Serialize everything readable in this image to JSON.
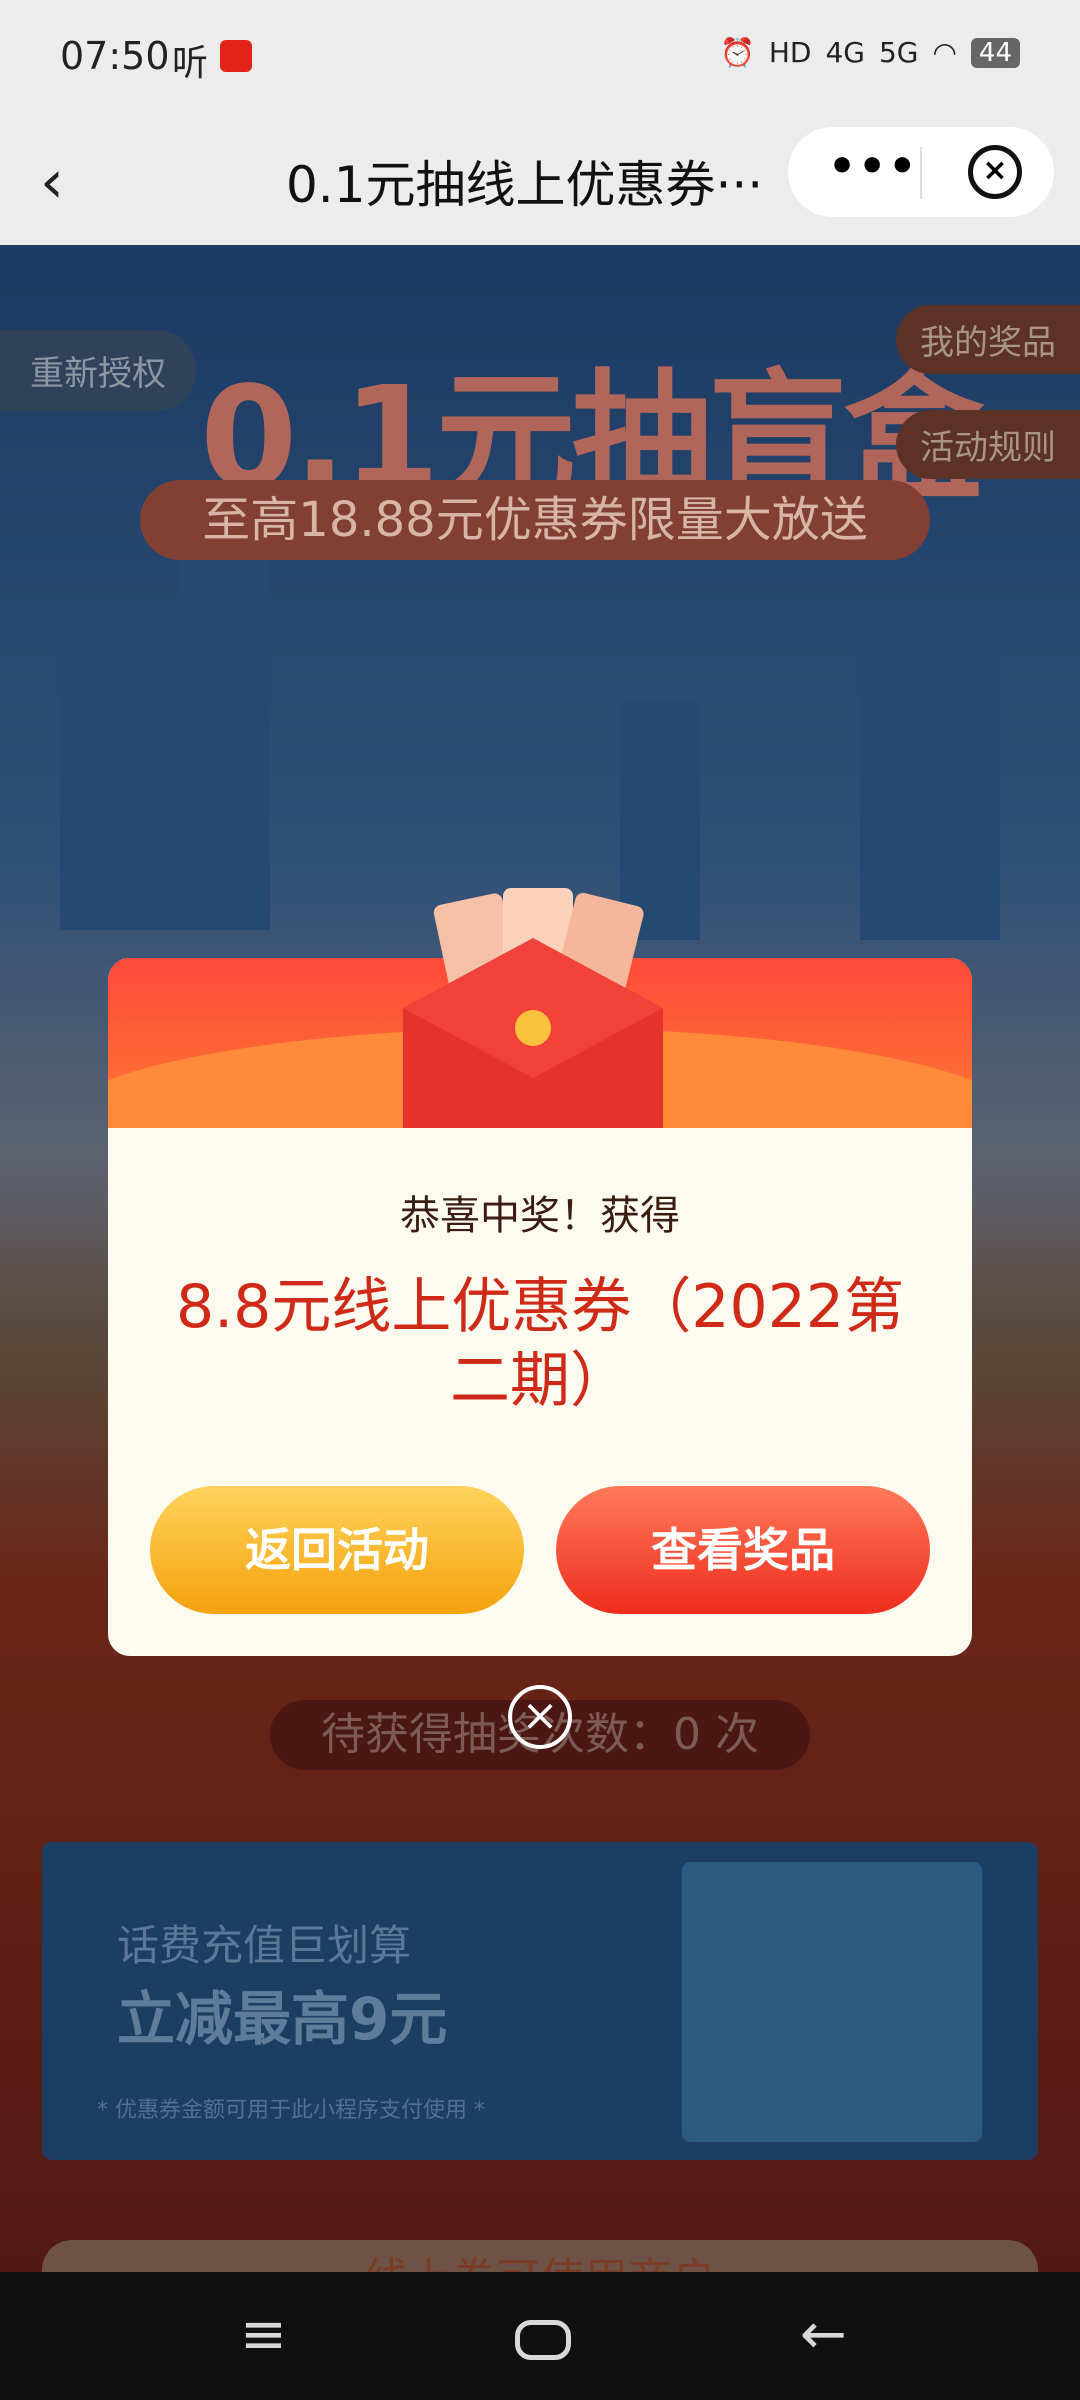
{
  "status_bar": {
    "time": "07:50",
    "app_label": "听",
    "network1": "HD",
    "network2": "4G",
    "network3": "5G",
    "battery": "44"
  },
  "navbar": {
    "title": "0.1元抽线上优惠券···",
    "more_label": "•••"
  },
  "page": {
    "reauth_label": "重新授权",
    "my_prizes_label": "我的奖品",
    "rules_label": "活动规则",
    "hero_title": "0.1元抽盲盒",
    "hero_subtitle": "至高18.88元优惠券限量大放送",
    "chances_text": "待获得抽奖次数：0 次",
    "banner": {
      "line1": "话费充值巨划算",
      "line2": "立减最高9元",
      "note": "* 优惠券金额可用于此小程序支付使用 *"
    },
    "coupon_section_title": "线上券可使用商户"
  },
  "modal": {
    "congrats": "恭喜中奖！获得",
    "prize": "8.8元线上优惠券（2022第二期）",
    "back_button": "返回活动",
    "view_button": "查看奖品"
  },
  "colors": {
    "accent_red": "#cf2a17",
    "button_orange": "#f4a10c",
    "button_red": "#ef2d1d"
  }
}
